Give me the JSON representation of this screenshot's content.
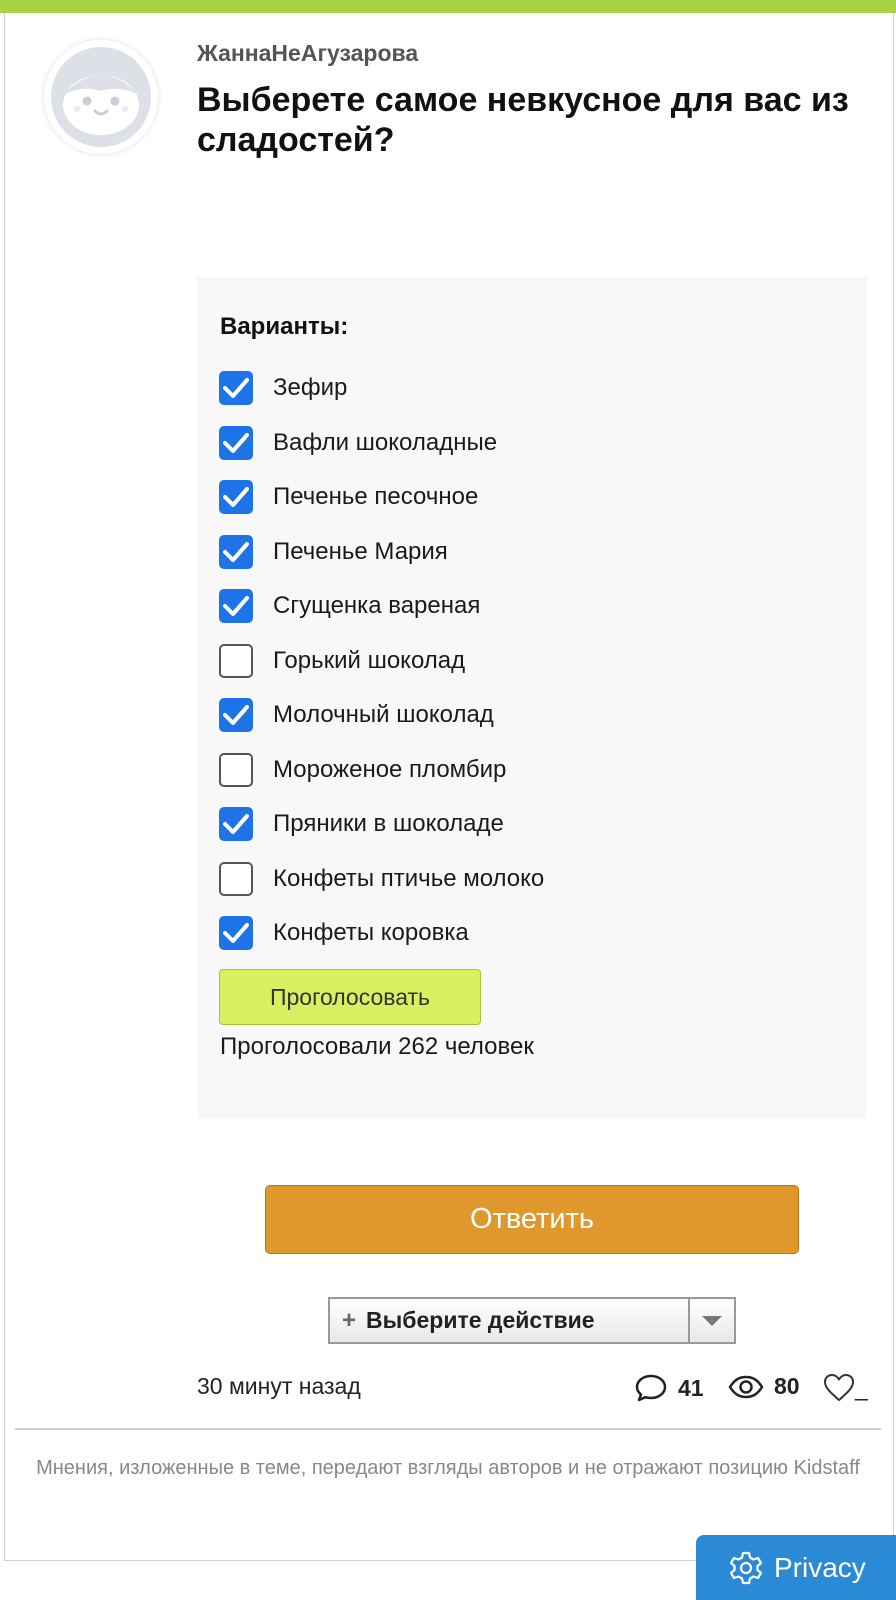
{
  "post": {
    "author": "ЖаннаНеАгузарова",
    "title": "Выберете самое невкусное для вас из сладостей?"
  },
  "poll": {
    "heading": "Варианты:",
    "options": [
      {
        "label": "Зефир",
        "checked": true
      },
      {
        "label": "Вафли шоколадные",
        "checked": true
      },
      {
        "label": "Печенье песочное",
        "checked": true
      },
      {
        "label": "Печенье Мария",
        "checked": true
      },
      {
        "label": "Сгущенка вареная",
        "checked": true
      },
      {
        "label": "Горький шоколад",
        "checked": false
      },
      {
        "label": "Молочный шоколад",
        "checked": true
      },
      {
        "label": "Мороженое пломбир",
        "checked": false
      },
      {
        "label": "Пряники в шоколаде",
        "checked": true
      },
      {
        "label": "Конфеты птичье молоко",
        "checked": false
      },
      {
        "label": "Конфеты коровка",
        "checked": true
      }
    ],
    "vote_button": "Проголосовать",
    "vote_count_text": "Проголосовали 262 человек"
  },
  "actions": {
    "reply_button": "Ответить",
    "select_plus": "+",
    "select_label": "Выберите действие"
  },
  "meta": {
    "time": "30 минут назад",
    "comments": "41",
    "views": "80",
    "likes": "_"
  },
  "footer": {
    "disclaimer": "Мнения, изложенные в теме, передают взгляды авторов и не отражают позицию Kidstaff"
  },
  "privacy": {
    "label": "Privacy"
  },
  "colors": {
    "accent_green": "#a6d344",
    "checkbox_blue": "#1e73e8",
    "vote_button": "#d7f060",
    "reply_button": "#e0972b",
    "privacy_button": "#2b8ad6"
  }
}
